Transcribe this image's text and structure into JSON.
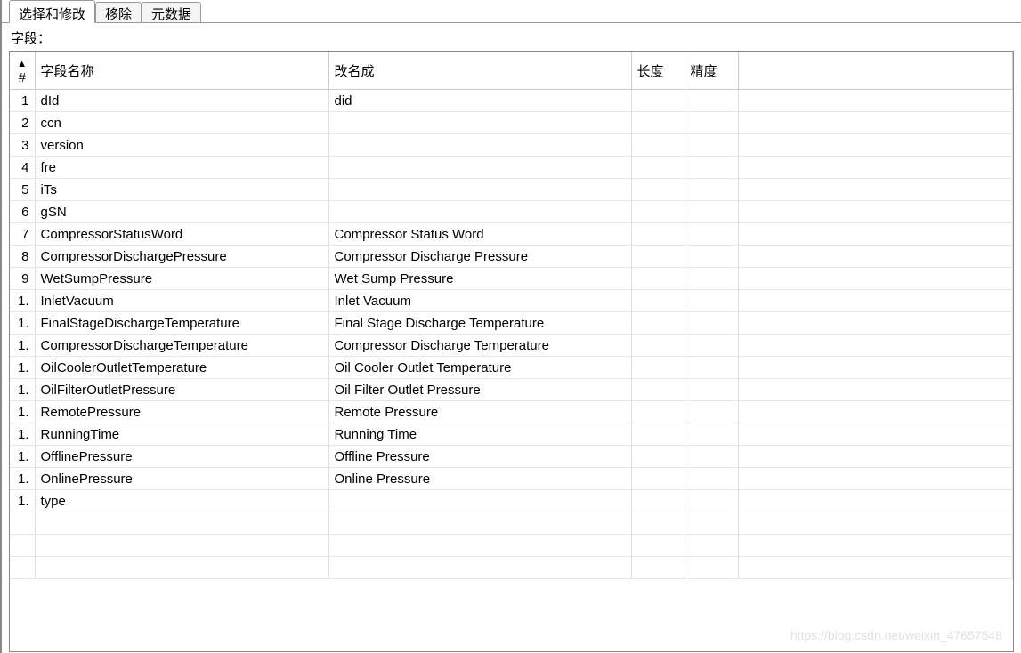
{
  "tabs": [
    {
      "label": "选择和修改",
      "active": true
    },
    {
      "label": "移除",
      "active": false
    },
    {
      "label": "元数据",
      "active": false
    }
  ],
  "section_label": "字段：",
  "columns": {
    "index": "#",
    "field_name": "字段名称",
    "rename_to": "改名成",
    "length": "长度",
    "precision": "精度"
  },
  "sort_indicator": "▲",
  "rows": [
    {
      "idx": "1",
      "field": "dId",
      "rename": "did",
      "length": "",
      "precision": ""
    },
    {
      "idx": "2",
      "field": "ccn",
      "rename": "",
      "length": "",
      "precision": ""
    },
    {
      "idx": "3",
      "field": "version",
      "rename": "",
      "length": "",
      "precision": ""
    },
    {
      "idx": "4",
      "field": "fre",
      "rename": "",
      "length": "",
      "precision": ""
    },
    {
      "idx": "5",
      "field": "iTs",
      "rename": "",
      "length": "",
      "precision": ""
    },
    {
      "idx": "6",
      "field": "gSN",
      "rename": "",
      "length": "",
      "precision": ""
    },
    {
      "idx": "7",
      "field": "CompressorStatusWord",
      "rename": "Compressor Status Word",
      "length": "",
      "precision": ""
    },
    {
      "idx": "8",
      "field": "CompressorDischargePressure",
      "rename": "Compressor Discharge Pressure",
      "length": "",
      "precision": ""
    },
    {
      "idx": "9",
      "field": "WetSumpPressure",
      "rename": "Wet Sump Pressure",
      "length": "",
      "precision": ""
    },
    {
      "idx": "1.",
      "field": "InletVacuum",
      "rename": "Inlet Vacuum",
      "length": "",
      "precision": ""
    },
    {
      "idx": "1.",
      "field": "FinalStageDischargeTemperature",
      "rename": "Final Stage Discharge Temperature",
      "length": "",
      "precision": ""
    },
    {
      "idx": "1.",
      "field": "CompressorDischargeTemperature",
      "rename": "Compressor Discharge Temperature",
      "length": "",
      "precision": ""
    },
    {
      "idx": "1.",
      "field": "OilCoolerOutletTemperature",
      "rename": "Oil Cooler Outlet Temperature",
      "length": "",
      "precision": ""
    },
    {
      "idx": "1.",
      "field": "OilFilterOutletPressure",
      "rename": "Oil Filter Outlet Pressure",
      "length": "",
      "precision": ""
    },
    {
      "idx": "1.",
      "field": "RemotePressure",
      "rename": "Remote Pressure",
      "length": "",
      "precision": ""
    },
    {
      "idx": "1.",
      "field": "RunningTime",
      "rename": "Running Time",
      "length": "",
      "precision": ""
    },
    {
      "idx": "1.",
      "field": "OfflinePressure",
      "rename": "Offline Pressure",
      "length": "",
      "precision": ""
    },
    {
      "idx": "1.",
      "field": "OnlinePressure",
      "rename": "Online Pressure",
      "length": "",
      "precision": ""
    },
    {
      "idx": "1.",
      "field": "type",
      "rename": "",
      "length": "",
      "precision": ""
    }
  ],
  "empty_rows": 3,
  "watermark": "https://blog.csdn.net/weixin_47657548"
}
